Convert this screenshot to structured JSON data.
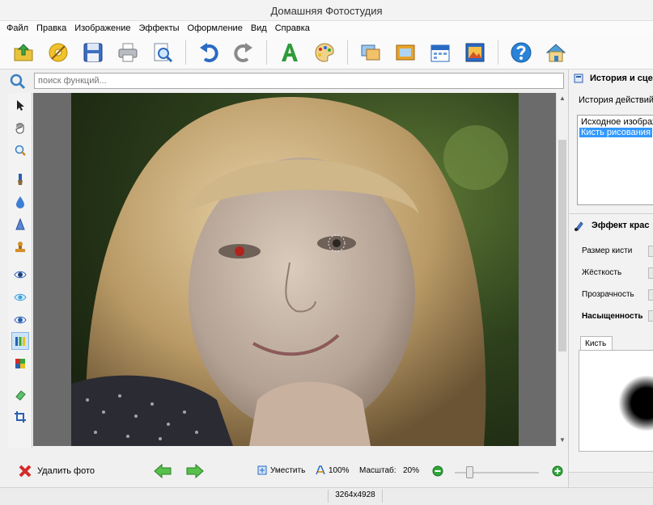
{
  "app": {
    "title": "Домашняя Фотостудия"
  },
  "menu": {
    "items": [
      "Файл",
      "Правка",
      "Изображение",
      "Эффекты",
      "Оформление",
      "Вид",
      "Справка"
    ]
  },
  "toolbar": {
    "buttons": [
      "open-icon",
      "effects-disc-icon",
      "save-icon",
      "print-icon",
      "preview-icon",
      "undo-icon",
      "redo-icon",
      "text-icon",
      "palette-icon",
      "collage-icon",
      "frame-icon",
      "calendar-icon",
      "postcard-icon",
      "help-icon",
      "house-icon"
    ]
  },
  "search": {
    "placeholder": "поиск функций..."
  },
  "tools": [
    "pointer-icon",
    "hand-icon",
    "zoom-icon",
    "brush-icon",
    "drop-icon",
    "cone-icon",
    "stamp-icon",
    "eye-icon",
    "eye-blue-icon",
    "eye-red-icon",
    "levels-icon",
    "colors-icon",
    "eraser-icon",
    "crop-icon"
  ],
  "bottom": {
    "delete_label": "Удалить фото",
    "fit_label": "Уместить",
    "zoom100_label": "100%",
    "scale_label": "Масштаб:",
    "scale_value": "20%",
    "scale_level": 0.2
  },
  "status": {
    "resolution": "3264x4928"
  },
  "panel": {
    "history_title": "История и сце",
    "history_sub": "История действий",
    "history_items": [
      "Исходное изображ",
      "Кисть рисования"
    ],
    "history_selected": 1,
    "effect_title": "Эффект крас",
    "params": [
      "Размер кисти",
      "Жёсткость",
      "Прозрачность",
      "Насыщенность"
    ],
    "brush_tab": "Кисть"
  },
  "colors": {
    "selection": "#3399ff",
    "accent": "#1c7ad4",
    "green": "#2ea83a"
  }
}
